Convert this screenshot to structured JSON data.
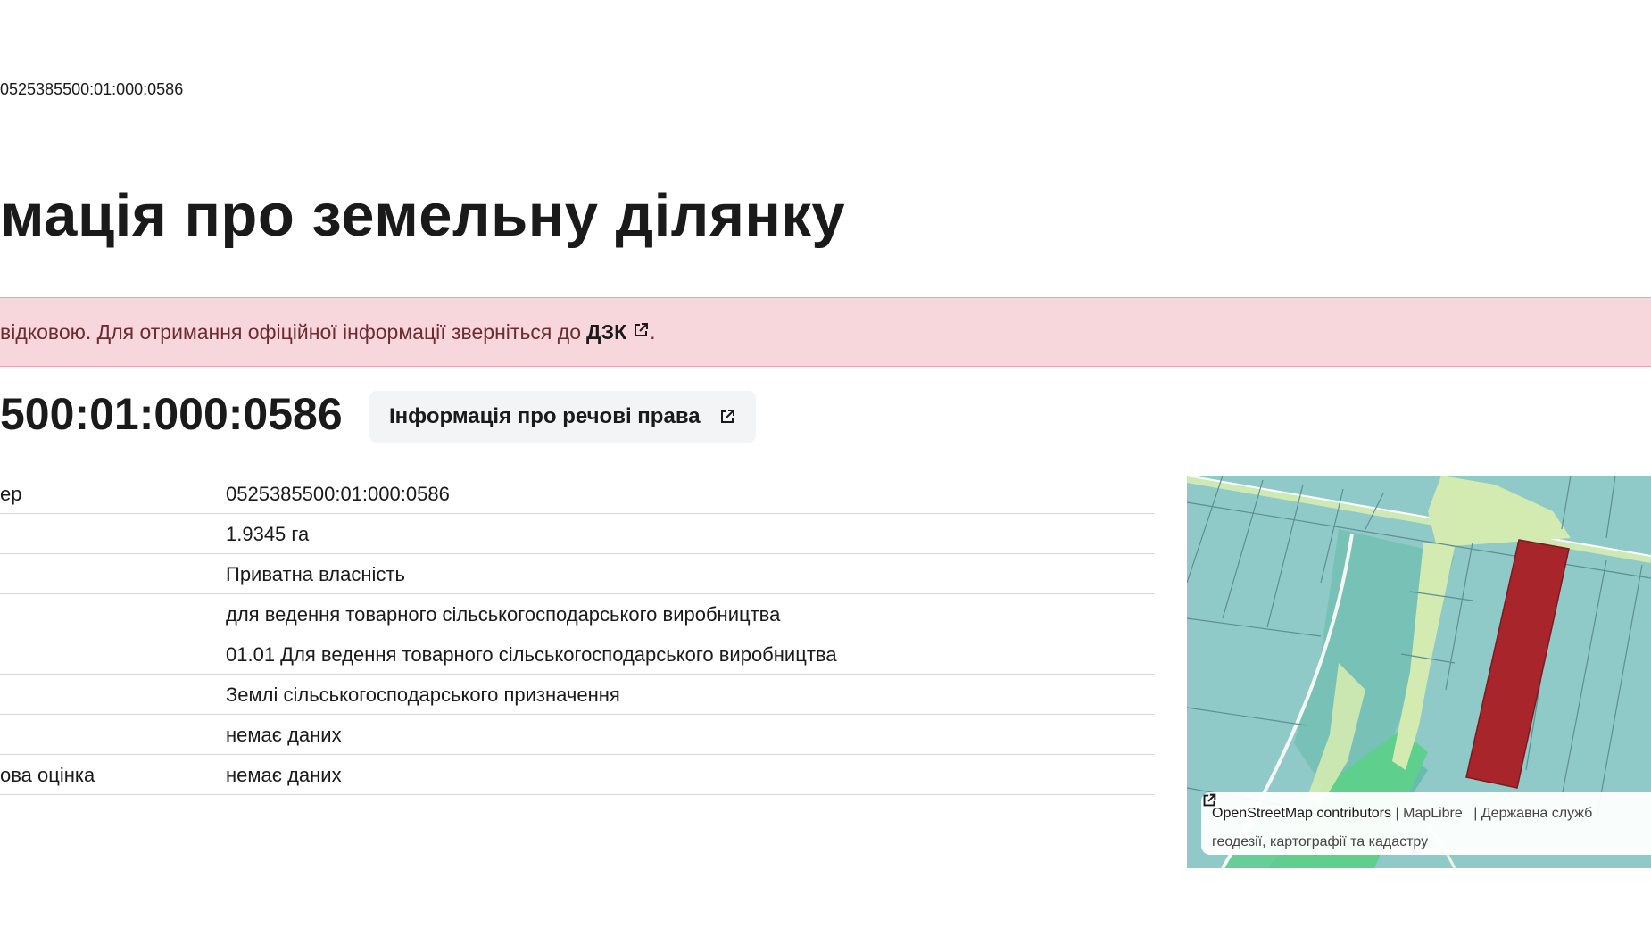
{
  "breadcrumb": "0525385500:01:000:0586",
  "page_title": "мація про земельну ділянку",
  "alert": {
    "text": "відковою. Для отримання офіційної інформації зверніться до",
    "link": "ДЗК",
    "end": "."
  },
  "parcel_number": "500:01:000:0586",
  "rights_button": "Інформація про речові права",
  "table": {
    "rows": [
      {
        "label": "ер",
        "value": "0525385500:01:000:0586"
      },
      {
        "label": "",
        "value": "1.9345 га"
      },
      {
        "label": "",
        "value": "Приватна власність"
      },
      {
        "label": "",
        "value": "для ведення товарного сільськогосподарського виробництва"
      },
      {
        "label": "",
        "value": "01.01 Для ведення товарного сільськогосподарського виробництва"
      },
      {
        "label": "",
        "value": "Землі сільськогосподарського призначення"
      },
      {
        "label": "",
        "value": "немає даних"
      },
      {
        "label": "ова оцінка",
        "value": "немає даних"
      }
    ]
  },
  "map": {
    "attribution": {
      "osm": "OpenStreetMap contributors",
      "sep1": "|",
      "maplibre": "MapLibre",
      "sep2": "|",
      "service_line1": "Державна служб",
      "service_line2": "геодезії, картографії та кадастру"
    },
    "colors": {
      "background": "#8fcac9",
      "parcel_highlight": "#a8262b",
      "light_green": "#d3ebb0",
      "forest_green": "#5fcf8e"
    }
  }
}
